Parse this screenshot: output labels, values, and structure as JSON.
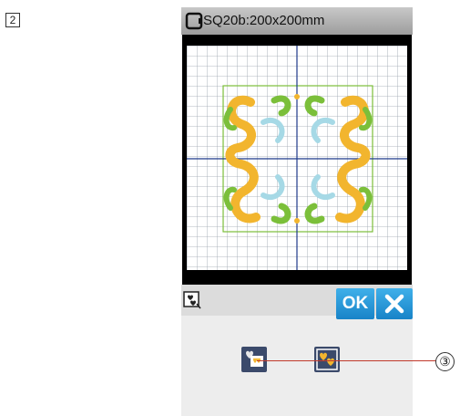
{
  "step": {
    "number": "2"
  },
  "title_bar": {
    "icon": "hoop-icon",
    "text": "SQ20b:200x200mm"
  },
  "toolbar": {
    "mode_icon": "display-mode-icon",
    "ok_label": "OK",
    "cancel_icon": "close-icon"
  },
  "options": [
    {
      "icon": "show-design-only-icon",
      "selected": false
    },
    {
      "icon": "show-design-with-frame-icon",
      "selected": true
    }
  ],
  "callout": {
    "label": "③"
  },
  "colors": {
    "accent": "#1e8fd6",
    "design_yellow": "#f2b52e",
    "design_green": "#7bbf3a",
    "design_cyan": "#a6d9e6",
    "grid_line": "#1e3a8a"
  }
}
